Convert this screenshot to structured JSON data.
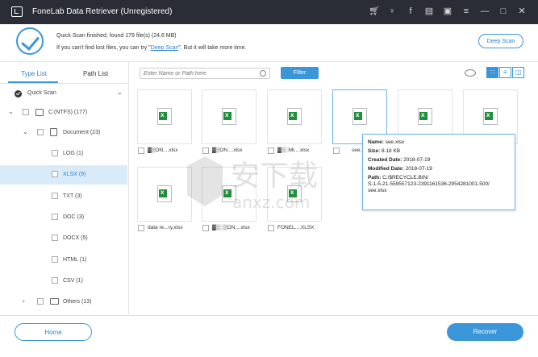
{
  "window": {
    "title": "FoneLab Data Retriever (Unregistered)"
  },
  "header": {
    "status_line": "Quick Scan finished, found 179 file(s) (24.6 MB)",
    "hint_prefix": "If you can't find lost files, you can try \"",
    "hint_link": "Deep Scan",
    "hint_suffix": "\". But it will take more time.",
    "deep_scan_button": "Deep Scan"
  },
  "sidebar": {
    "tabs": [
      "Type List",
      "Path List"
    ],
    "scan_mode": "Quick Scan",
    "drive": "C:(NTFS) (177)",
    "document": "Document (23)",
    "types": [
      "LOG (1)",
      "XLSX (9)",
      "TXT (3)",
      "DOC (3)",
      "DOCX (5)",
      "HTML (1)",
      "CSV (1)"
    ],
    "others": "Others (13)"
  },
  "toolbar": {
    "search_placeholder": "Enter Name or Path here",
    "filter_button": "Filter"
  },
  "files": [
    {
      "name": "▓▒ON....xlsx"
    },
    {
      "name": "▓▒ON....xlsx"
    },
    {
      "name": "▓▒░Mi....xlsx"
    },
    {
      "name": "see.xlsx"
    },
    {
      "name": ""
    },
    {
      "name": ""
    },
    {
      "name": "data re...ry.xlsx"
    },
    {
      "name": "▓▒░▒ON....xlsx"
    },
    {
      "name": "FONEL....XLSX"
    }
  ],
  "tooltip": {
    "name_label": "Name:",
    "name": "see.xlsx",
    "size_label": "Size:",
    "size": "8.18 KB",
    "created_label": "Created Date:",
    "created": "2018-07-19",
    "modified_label": "Modified Date:",
    "modified": "2018-07-19",
    "path_label": "Path:",
    "path1": "C:/$RECYCLE.BIN/",
    "path2": "S-1-5-21-559557123-2391161536-2954281001-500/",
    "path3": "see.xlsx"
  },
  "watermark": {
    "cn": "安下载",
    "en": "anxz.com"
  },
  "footer": {
    "home_button": "Home",
    "recover_button": "Recover"
  },
  "colors": {
    "accent": "#3a96d8",
    "titlebar": "#2a2d36",
    "selected_row": "#d9ebf9"
  }
}
